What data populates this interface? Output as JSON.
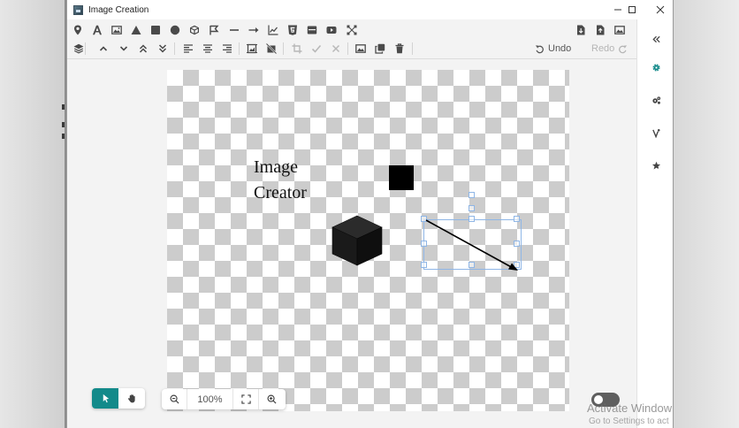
{
  "window": {
    "title": "Image Creation",
    "controls": [
      "minimize-icon",
      "maximize-icon",
      "close-icon"
    ]
  },
  "toolbar": {
    "row1_left": [
      "location-pin-icon",
      "text-icon",
      "image-icon",
      "triangle-icon",
      "square-icon",
      "circle-icon",
      "cube-icon",
      "flag-icon",
      "line-icon",
      "arrow-icon",
      "line-chart-icon",
      "html5-icon",
      "card-icon",
      "youtube-icon",
      "network-icon"
    ],
    "row1_right": [
      "export-file-icon",
      "import-file-icon",
      "picture-icon"
    ],
    "row2": [
      "layers-icon",
      "move-up-icon",
      "move-down-icon",
      "bring-to-front-icon",
      "send-to-back-icon",
      "align-left-icon",
      "align-center-icon",
      "align-right-icon",
      "crop-image-icon",
      "remove-crop-icon",
      "crop-icon",
      "check-icon",
      "cancel-icon",
      "replace-image-icon",
      "duplicate-icon",
      "delete-icon"
    ],
    "undo_label": "Undo",
    "redo_label": "Redo"
  },
  "sidebar": {
    "items": [
      "collapse-icon",
      "settings-icon",
      "advanced-settings-icon",
      "vector-icon",
      "favorites-icon"
    ]
  },
  "canvas": {
    "text_line1": "Image",
    "text_line2": "Creator"
  },
  "bottom": {
    "zoom_level": "100%"
  },
  "watermark": {
    "line1": "Activate Window",
    "line2": "Go to Settings to act"
  },
  "colors": {
    "accent": "#138a8a",
    "toolbar_bg": "#f3f3f3",
    "selection": "#8fb6e6"
  }
}
